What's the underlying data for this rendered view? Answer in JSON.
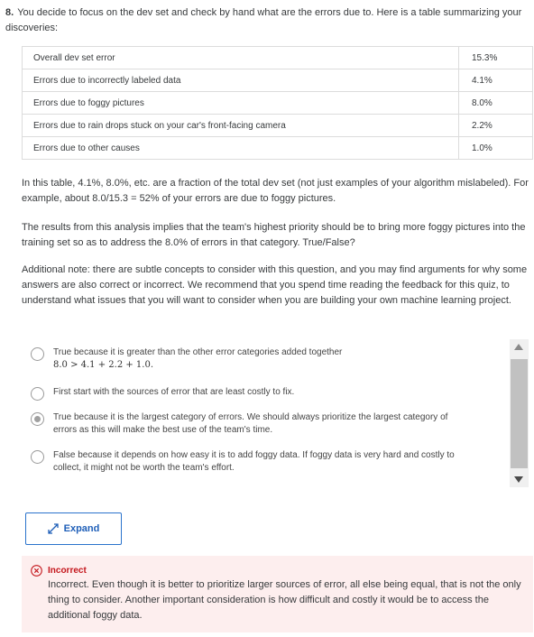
{
  "question": {
    "number": "8.",
    "text": "You decide to focus on the dev set and check by hand what are the errors due to. Here is a table summarizing your discoveries:"
  },
  "table": {
    "rows": [
      {
        "label": "Overall dev set error",
        "value": "15.3%"
      },
      {
        "label": "Errors due to incorrectly labeled data",
        "value": "4.1%"
      },
      {
        "label": "Errors due to foggy pictures",
        "value": "8.0%"
      },
      {
        "label": "Errors due to rain drops stuck on your car's front-facing camera",
        "value": "2.2%"
      },
      {
        "label": "Errors due to other causes",
        "value": "1.0%"
      }
    ]
  },
  "paragraphs": [
    "In this table, 4.1%, 8.0%, etc. are a fraction of the total dev set (not just examples of your algorithm mislabeled). For example, about 8.0/15.3 = 52% of your errors are due to foggy pictures.",
    "The results from this analysis implies that the team's highest priority should be to bring more foggy pictures into the training set so as to address the 8.0% of errors in that category. True/False?",
    "Additional note: there are subtle concepts to consider with this question, and you may find arguments for why some answers are also correct or incorrect. We recommend that you spend time reading the feedback for this quiz, to understand what issues that you will want to consider when you are building your own machine learning project."
  ],
  "options": [
    {
      "text": "True because it is greater than the other error categories added together",
      "formula": "8.0 > 4.1 + 2.2 + 1.0.",
      "selected": false
    },
    {
      "text": "First start with the sources of error that are least costly to fix.",
      "selected": false
    },
    {
      "text": "True because it is the largest category of errors. We should always prioritize the largest category of errors as this will make the best use of the team's time.",
      "selected": true
    },
    {
      "text": "False because it depends on how easy it is to add foggy data. If foggy data is very hard and costly to collect, it might not be worth the team's effort.",
      "selected": false
    }
  ],
  "expand_button": {
    "label": "Expand",
    "icon": "expand-arrows-icon",
    "color": "#2a73cc"
  },
  "feedback": {
    "status": "Incorrect",
    "icon": "x-circle-icon",
    "status_color": "#c4161c",
    "background": "#fdeeee",
    "text": "Incorrect. Even though it is better to prioritize larger sources of error, all else being equal, that is not the only thing to consider. Another important consideration is how difficult and costly it would be to access the additional foggy data."
  }
}
